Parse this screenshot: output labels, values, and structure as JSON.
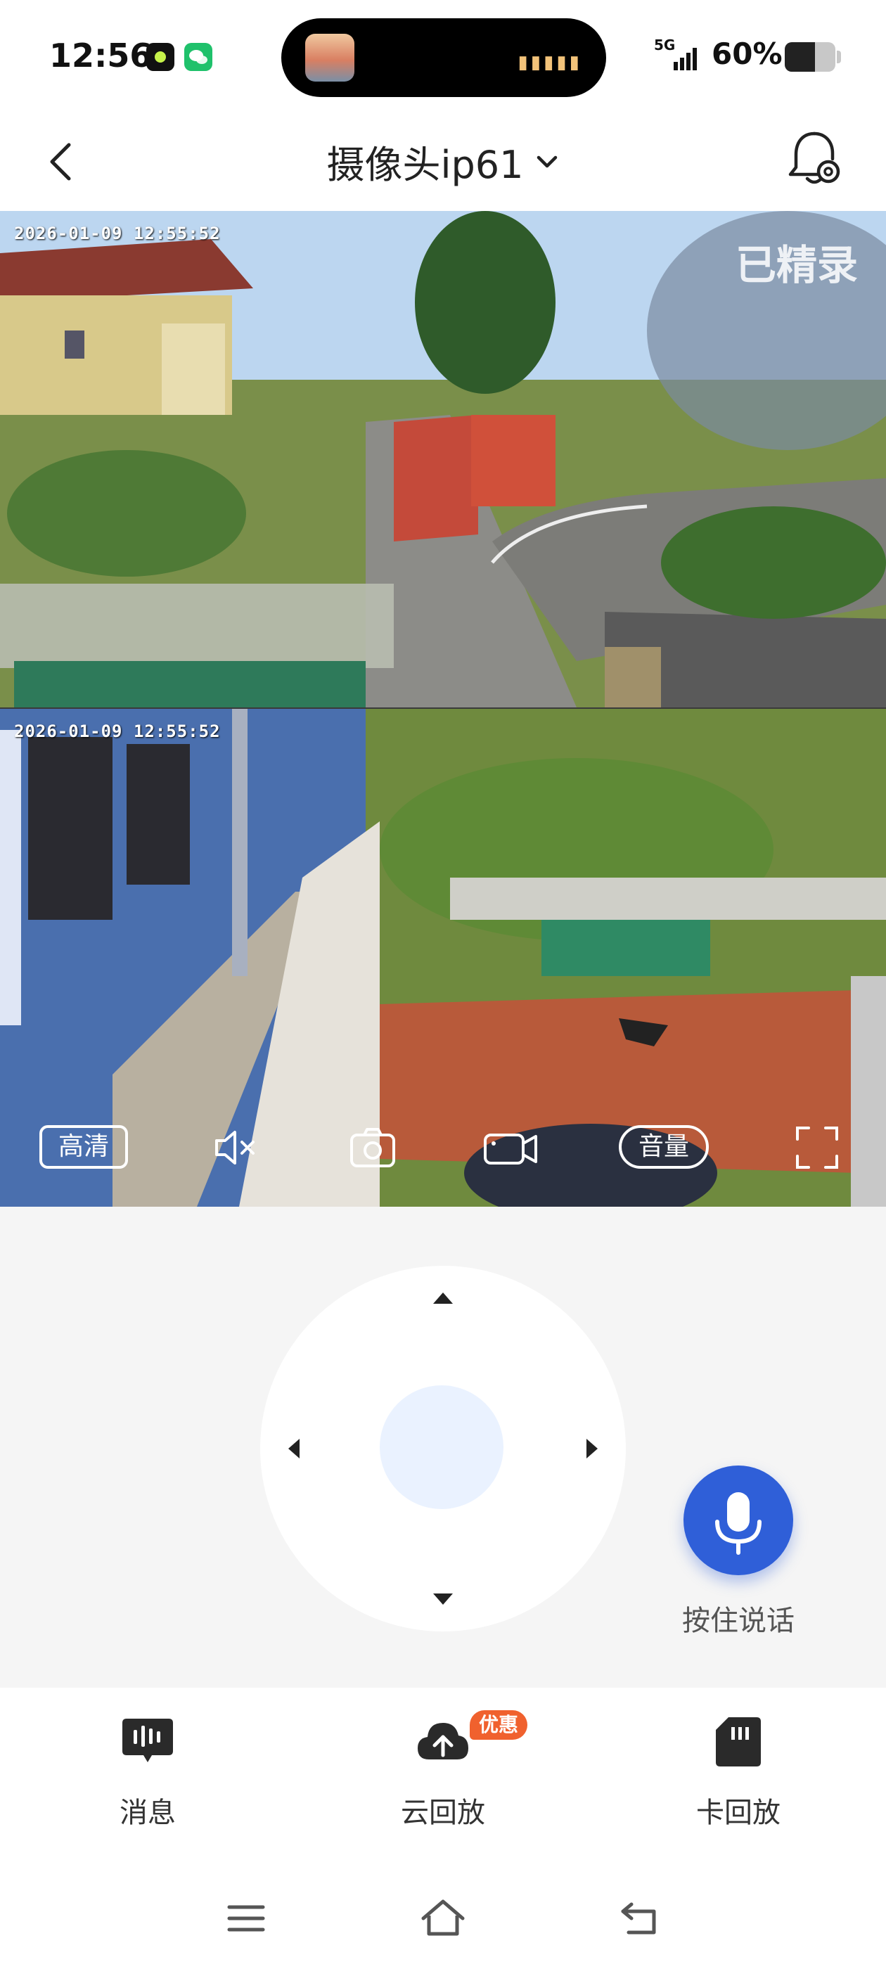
{
  "status_bar": {
    "time": "12:56",
    "network": "5G",
    "battery_text": "60%",
    "battery_level": 0.6
  },
  "header": {
    "title": "摄像头ip61"
  },
  "video": {
    "timestamp_top": "2026-01-09 12:55:52",
    "timestamp_bottom": "2026-01-09 12:55:52",
    "overlay_text": "已精录",
    "quality_label": "高清",
    "volume_label": "音量"
  },
  "talk": {
    "label": "按住说话",
    "accent": "#2f5fd8"
  },
  "bottom_tabs": [
    {
      "label": "消息",
      "icon": "message-icon"
    },
    {
      "label": "云回放",
      "icon": "cloud-upload-icon",
      "badge": "优惠"
    },
    {
      "label": "卡回放",
      "icon": "sd-card-icon"
    }
  ],
  "colors": {
    "promo": "#f0612e",
    "ptz_center": "#eaf2ff"
  }
}
